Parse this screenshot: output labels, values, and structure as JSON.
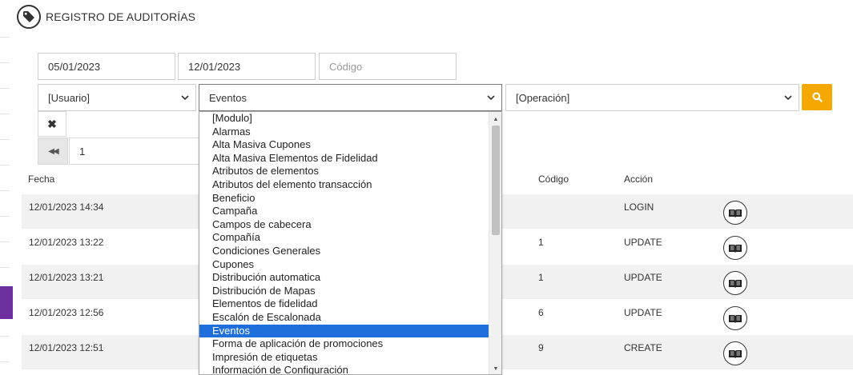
{
  "page": {
    "title": "REGISTRO DE AUDITORÍAS",
    "title_icon": "tag-icon"
  },
  "filters": {
    "date_from": "05/01/2023",
    "date_to": "12/01/2023",
    "code_placeholder": "Código",
    "user_select": "[Usuario]",
    "module_select": "Eventos",
    "operation_select": "[Operación]",
    "search_icon": "search-icon",
    "clear_label": "✖",
    "first_page_label": "◀◀",
    "page_value": "1"
  },
  "table": {
    "headers": {
      "fecha": "Fecha",
      "codigo": "Código",
      "accion": "Acción"
    },
    "rows": [
      {
        "fecha": "12/01/2023 14:34",
        "codigo": "",
        "accion": "LOGIN"
      },
      {
        "fecha": "12/01/2023 13:22",
        "codigo": "1",
        "accion": "UPDATE"
      },
      {
        "fecha": "12/01/2023 13:21",
        "codigo": "1",
        "accion": "UPDATE"
      },
      {
        "fecha": "12/01/2023 12:56",
        "codigo": "6",
        "accion": "UPDATE"
      },
      {
        "fecha": "12/01/2023 12:51",
        "codigo": "9",
        "accion": "CREATE"
      }
    ],
    "detail_icon": "book-icon"
  },
  "dropdown": {
    "selected": "Eventos",
    "options": [
      "[Modulo]",
      "Alarmas",
      "Alta Masiva Cupones",
      "Alta Masiva Elementos de Fidelidad",
      "Atributos de elementos",
      "Atributos del elemento transacción",
      "Beneficio",
      "Campaña",
      "Campos de cabecera",
      "Compañía",
      "Condiciones Generales",
      "Cupones",
      "Distribución automatica",
      "Distribución de Mapas",
      "Elementos de fidelidad",
      "Escalón de Escalonada",
      "Eventos",
      "Forma de aplicación de promociones",
      "Impresión de etiquetas",
      "Información de Configuración"
    ]
  },
  "colors": {
    "accent": "#f5a800",
    "selected_option": "#1e6fdc",
    "sidebar_active": "#6b2fa0"
  }
}
